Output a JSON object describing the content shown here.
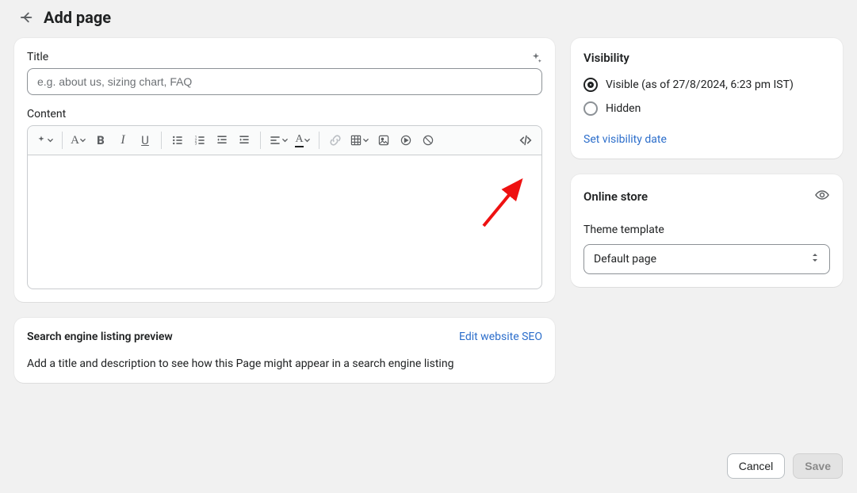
{
  "header": {
    "title": "Add page"
  },
  "main": {
    "title_label": "Title",
    "title_placeholder": "e.g. about us, sizing chart, FAQ",
    "content_label": "Content"
  },
  "seo": {
    "heading": "Search engine listing preview",
    "edit_link": "Edit website SEO",
    "description": "Add a title and description to see how this Page might appear in a search engine listing"
  },
  "visibility": {
    "heading": "Visibility",
    "visible_label": "Visible (as of 27/8/2024, 6:23 pm IST)",
    "hidden_label": "Hidden",
    "link": "Set visibility date"
  },
  "online_store": {
    "heading": "Online store",
    "template_label": "Theme template",
    "template_value": "Default page"
  },
  "actions": {
    "cancel": "Cancel",
    "save": "Save"
  }
}
